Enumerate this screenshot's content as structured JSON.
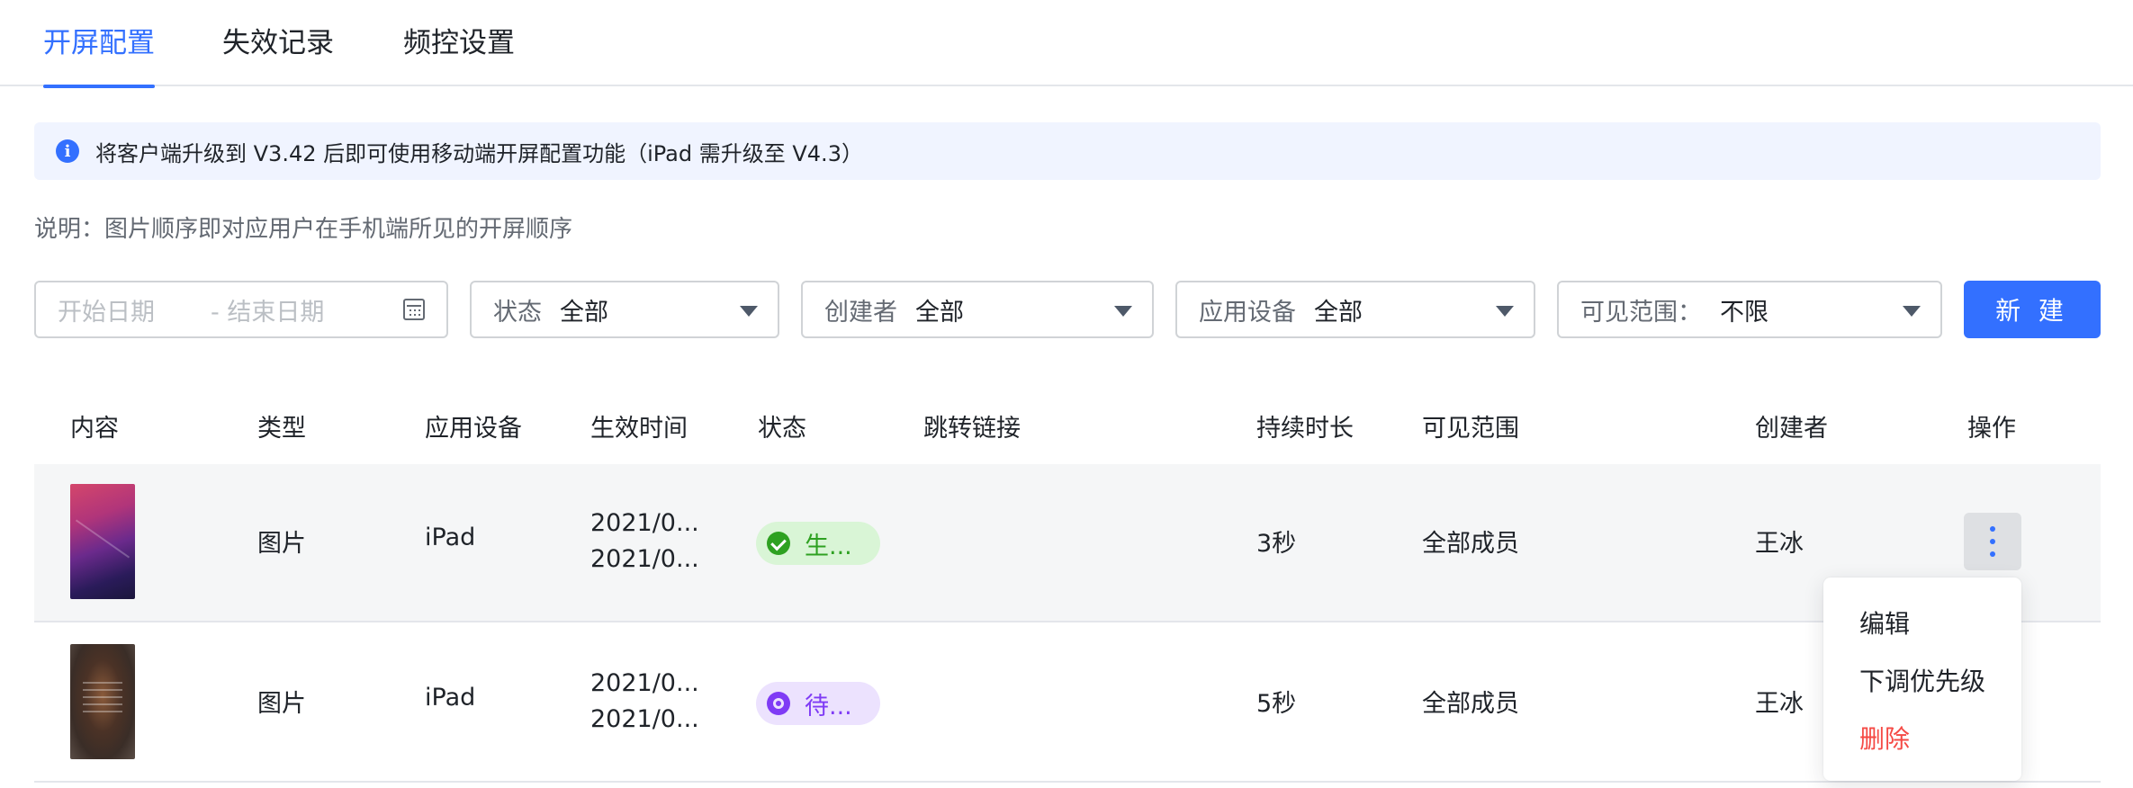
{
  "tabs": [
    {
      "label": "开屏配置",
      "active": true
    },
    {
      "label": "失效记录",
      "active": false
    },
    {
      "label": "频控设置",
      "active": false
    }
  ],
  "notice": {
    "icon": "info-icon",
    "text": "将客户端升级到 V3.42 后即可使用移动端开屏配置功能（iPad 需升级至 V4.3）"
  },
  "description": "说明：图片顺序即对应用户在手机端所见的开屏顺序",
  "filters": {
    "date": {
      "start_placeholder": "开始日期",
      "end_placeholder": "- 结束日期"
    },
    "status": {
      "label": "状态",
      "value": "全部"
    },
    "creator": {
      "label": "创建者",
      "value": "全部"
    },
    "device": {
      "label": "应用设备",
      "value": "全部"
    },
    "range": {
      "label": "可见范围：",
      "value": "不限"
    }
  },
  "new_button": "新 建",
  "columns": [
    "内容",
    "类型",
    "应用设备",
    "生效时间",
    "状态",
    "跳转链接",
    "持续时长",
    "可见范围",
    "创建者",
    "操作"
  ],
  "rows": [
    {
      "type": "图片",
      "device": "iPad",
      "time_start": "2021/0...",
      "time_end": "2021/0...",
      "status": "生...",
      "status_kind": "active",
      "link": "",
      "duration": "3秒",
      "range": "全部成员",
      "creator": "王冰"
    },
    {
      "type": "图片",
      "device": "iPad",
      "time_start": "2021/0...",
      "time_end": "2021/0...",
      "status": "待...",
      "status_kind": "pending",
      "link": "",
      "duration": "5秒",
      "range": "全部成员",
      "creator": "王冰"
    }
  ],
  "row_menu": {
    "items": [
      "编辑",
      "下调优先级",
      "删除"
    ]
  },
  "colors": {
    "accent": "#3370ff",
    "success": "#2ea121",
    "pending": "#7f3bf5",
    "danger": "#f54a45"
  }
}
